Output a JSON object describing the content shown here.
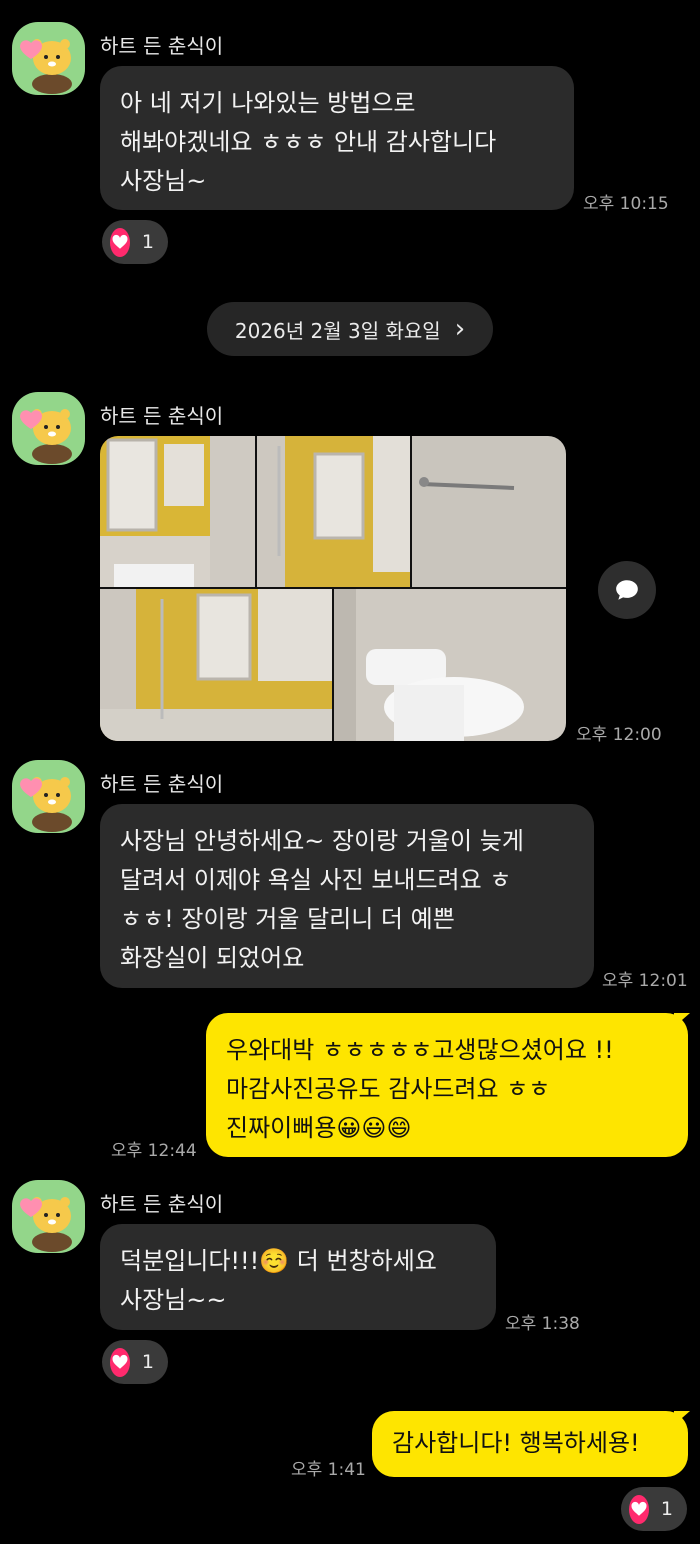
{
  "messages": {
    "m1": {
      "sender": "하트 든 춘식이",
      "text": "아 네 저기 나와있는 방법으로\n해봐야겠네요 ㅎㅎㅎ 안내 감사합니다\n사장님~",
      "time": "오후 10:15",
      "reaction_count": "1"
    },
    "date_divider": {
      "label": "2026년 2월 3일 화요일",
      "chevron": "›"
    },
    "m2": {
      "sender": "하트 든 춘식이",
      "time": "오후 12:00",
      "photo_count": 5
    },
    "m3": {
      "sender": "하트 든 춘식이",
      "text": "사장님 안녕하세요~ 장이랑 거울이 늦게\n달려서 이제야 욕실 사진 보내드려요 ㅎ\nㅎㅎ! 장이랑 거울 달리니 더 예쁜\n화장실이 되었어요",
      "time": "오후 12:01"
    },
    "m4": {
      "text": "우와대박 ㅎㅎㅎㅎㅎ고생많으셨어요 !!\n마감사진공유도 감사드려요 ㅎㅎ\n진짜이뻐용😀😃😄",
      "time": "오후 12:44"
    },
    "m5": {
      "sender": "하트 든 춘식이",
      "text": "덕분입니다!!!☺️ 더 번창하세요\n사장님~~",
      "time": "오후 1:38",
      "reaction_count": "1"
    },
    "m6": {
      "text": "감사합니다! 행복하세용!",
      "time": "오후 1:41",
      "reaction_count": "1"
    }
  },
  "icons": {
    "avatar": "choonsik-heart-avatar",
    "reaction": "heart-icon",
    "comment": "speech-bubble-icon"
  },
  "colors": {
    "background": "#000000",
    "incoming_bubble": "#2b2b2b",
    "outgoing_bubble": "#fee500",
    "heart": "#ff2a6d"
  }
}
